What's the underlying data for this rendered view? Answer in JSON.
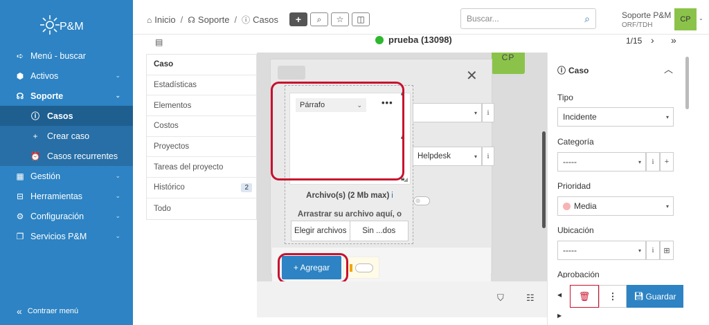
{
  "sidebar": {
    "logo_text": "P&M",
    "items": [
      {
        "icon": "arrow-right-icon",
        "label": "Menú - buscar"
      },
      {
        "icon": "cube-icon",
        "label": "Activos"
      },
      {
        "icon": "headset-icon",
        "label": "Soporte"
      },
      {
        "icon": "info-circle-icon",
        "label": "Casos"
      },
      {
        "icon": "plus-icon",
        "label": "Crear caso"
      },
      {
        "icon": "alarm-clock-icon",
        "label": "Casos recurrentes"
      },
      {
        "icon": "building-icon",
        "label": "Gestión"
      },
      {
        "icon": "toolbox-icon",
        "label": "Herramientas"
      },
      {
        "icon": "gear-icon",
        "label": "Configuración"
      },
      {
        "icon": "copy-icon",
        "label": "Servicios P&M"
      }
    ],
    "collapse_label": "Contraer menú"
  },
  "breadcrumb": {
    "home": "Inicio",
    "support": "Soporte",
    "cases": "Casos"
  },
  "search": {
    "placeholder": "Buscar..."
  },
  "user": {
    "name": "Soporte P&M",
    "org": "ORF/TDH",
    "initials": "CP"
  },
  "case": {
    "title": "prueba (13098)",
    "pager": "1/15"
  },
  "tabs": [
    {
      "label": "Caso"
    },
    {
      "label": "Estadísticas"
    },
    {
      "label": "Elementos"
    },
    {
      "label": "Costos"
    },
    {
      "label": "Proyectos"
    },
    {
      "label": "Tareas del proyecto"
    },
    {
      "label": "Histórico",
      "badge": "2"
    },
    {
      "label": "Todo"
    }
  ],
  "modal": {
    "tag": "CP",
    "format_select": "Párrafo",
    "more": "•••",
    "files_label": "Archivo(s) (2 Mb max)",
    "drag_label": "Arrastrar su archivo aquí, o",
    "choose_files": "Elegir archivos",
    "no_files": "Sin ...dos",
    "helpdesk_value": "Helpdesk",
    "add_button": "+ Agregar"
  },
  "right_panel": {
    "section": "Caso",
    "tipo_label": "Tipo",
    "tipo_value": "Incidente",
    "categoria_label": "Categoría",
    "categoria_value": "-----",
    "prioridad_label": "Prioridad",
    "prioridad_value": "Media",
    "ubicacion_label": "Ubicación",
    "ubicacion_value": "-----",
    "aprobacion_label": "Aprobación",
    "save_label": "Guardar"
  },
  "colors": {
    "sidebar": "#2d83c3",
    "accent": "#2d83c3",
    "status_green": "#2eb82e",
    "highlight_red": "#c8102e",
    "avatar_green": "#8bc34a"
  }
}
